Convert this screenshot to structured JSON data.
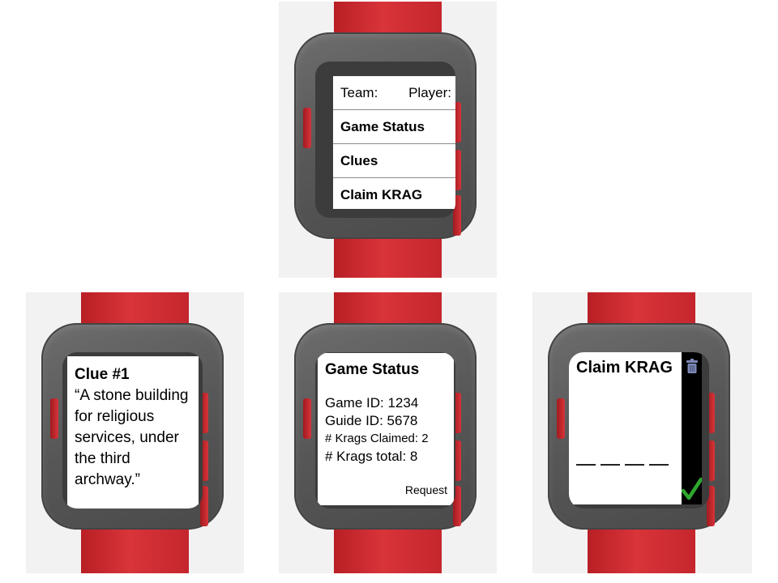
{
  "menu": {
    "team_label": "Team:",
    "player_label": "Player:",
    "items": [
      {
        "label": "Game Status"
      },
      {
        "label": "Clues"
      },
      {
        "label": "Claim KRAG"
      }
    ]
  },
  "clue": {
    "title": "Clue #1",
    "text": "“A stone building for religious services, under the third archway.”"
  },
  "status": {
    "title": "Game Status",
    "game_id": "Game ID: 1234",
    "guide_id": "Guide ID: 5678",
    "krags_claimed": "# Krags Claimed: 2",
    "krags_total": "# Krags total: 8",
    "request_label": "Request"
  },
  "claim": {
    "title": "Claim KRAG",
    "code_slots": 4,
    "icons": {
      "delete": "trash-icon",
      "confirm": "checkmark-icon"
    },
    "colors": {
      "trash": "#7f89b8",
      "check": "#2ea82e"
    }
  },
  "watch": {
    "strap_color": "#d8343a",
    "case_color": "#5b5b5b"
  }
}
